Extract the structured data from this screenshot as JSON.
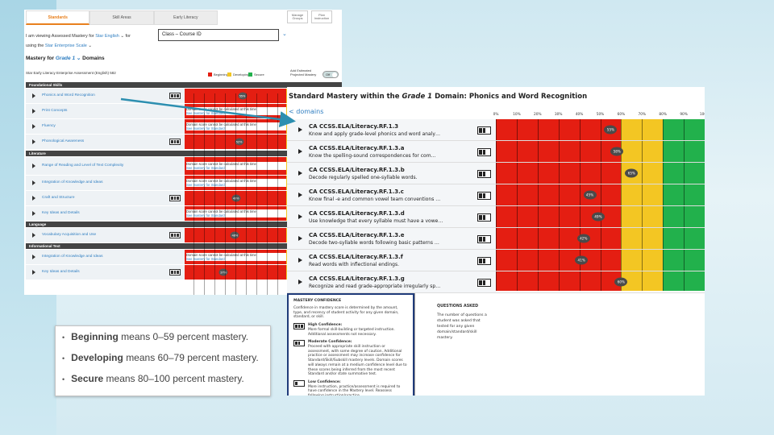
{
  "colors": {
    "beginning": "#e41e12",
    "developing": "#f3c623",
    "secure": "#22b14c",
    "link": "#2f7ec1",
    "arrow": "#2d8fb0"
  },
  "left": {
    "tabs": [
      "Standards",
      "Skill Areas",
      "Early Literacy"
    ],
    "top_buttons": [
      "Manage Groups",
      "Plan Instruction"
    ],
    "viewing_line": {
      "prefix": "I am viewing Assessed Mastery for",
      "subject": "Star English",
      "mid": "for"
    },
    "class_box": "Class – Course ID",
    "using_line": {
      "prefix": "using the",
      "scale": "Star Enterprise Scale"
    },
    "mastery_title": {
      "prefix": "Mastery for",
      "grade": "Grade 1",
      "suffix": "Domains"
    },
    "assessment": "Star Early Literacy Enterprise Assessment (English) 582",
    "legend": [
      "Beginning",
      "Developing",
      "Secure"
    ],
    "toggle_label": "Add Estimated Projected Mastery",
    "toggle_state": "Off",
    "percent_ticks": [
      "0%",
      "10%",
      "20%",
      "30%",
      "40%",
      "50%",
      "60%",
      "70%",
      "80%",
      "90%",
      "100%"
    ],
    "sections": [
      {
        "name": "Foundational Skills",
        "rows": [
          {
            "name": "Phonics and Word Recognition",
            "pct": "55%",
            "value": 55
          },
          {
            "name": "Print Concepts",
            "msg": "Domain score cannot be calculated at this time",
            "see": "See mastery for Standard"
          },
          {
            "name": "Fluency",
            "msg": "Domain score cannot be calculated at this time",
            "see": "See mastery for Standard"
          },
          {
            "name": "Phonological Awareness",
            "pct": "52%",
            "value": 52
          }
        ]
      },
      {
        "name": "Literature",
        "rows": [
          {
            "name": "Range of Reading and Level of Text Complexity",
            "msg": "Domain score cannot be calculated at this time",
            "see": "See mastery for Standard"
          },
          {
            "name": "Integration of Knowledge and Ideas",
            "msg": "Domain score cannot be calculated at this time",
            "see": "See mastery for Standard"
          },
          {
            "name": "Craft and Structure",
            "pct": "49%",
            "value": 49
          },
          {
            "name": "Key Ideas and Details",
            "msg": "Domain score cannot be calculated at this time",
            "see": "See mastery for Standard"
          }
        ]
      },
      {
        "name": "Language",
        "rows": [
          {
            "name": "Vocabulary Acquisition and Use",
            "pct": "48%",
            "value": 48
          }
        ]
      },
      {
        "name": "Informational Text",
        "rows": [
          {
            "name": "Integration of Knowledge and Ideas",
            "msg": "Domain score cannot be calculated at this time",
            "see": "See mastery for Standard"
          },
          {
            "name": "Key Ideas and Details",
            "pct": "37%",
            "value": 37
          }
        ]
      }
    ]
  },
  "right": {
    "title": {
      "prefix": "Standard Mastery within the",
      "grade": "Grade 1",
      "suffix": "Domain: Phonics and Word Recognition"
    },
    "back": "< domains",
    "percent_ticks": [
      "0%",
      "10%",
      "20%",
      "30%",
      "40%",
      "50%",
      "60%",
      "70%",
      "80%",
      "90%",
      "100%"
    ],
    "rows": [
      {
        "code": "CA CCSS.ELA/Literacy.RF.1.3",
        "desc": "Know and apply grade-level phonics and word analy…",
        "pct": "55%",
        "value": 55
      },
      {
        "code": "CA CCSS.ELA/Literacy.RF.1.3.a",
        "desc": "Know the spelling-sound correspondences for com…",
        "pct": "58%",
        "value": 58
      },
      {
        "code": "CA CCSS.ELA/Literacy.RF.1.3.b",
        "desc": "Decode regularly spelled one-syllable words.",
        "pct": "65%",
        "value": 65
      },
      {
        "code": "CA CCSS.ELA/Literacy.RF.1.3.c",
        "desc": "Know final -e and common vowel team conventions …",
        "pct": "45%",
        "value": 45
      },
      {
        "code": "CA CCSS.ELA/Literacy.RF.1.3.d",
        "desc": "Use knowledge that every syllable must have a vowe…",
        "pct": "49%",
        "value": 49
      },
      {
        "code": "CA CCSS.ELA/Literacy.RF.1.3.e",
        "desc": "Decode two-syllable words following basic patterns …",
        "pct": "42%",
        "value": 42
      },
      {
        "code": "CA CCSS.ELA/Literacy.RF.1.3.f",
        "desc": "Read words with inflectional endings.",
        "pct": "41%",
        "value": 41
      },
      {
        "code": "CA CCSS.ELA/Literacy.RF.1.3.g",
        "desc": "Recognize and read grade-appropriate irregularly sp…",
        "pct": "60%",
        "value": 60
      }
    ],
    "confidence": {
      "title": "MASTERY CONFIDENCE",
      "intro": "Confidence in mastery score is determined by the amount, type, and recency of student activity for any given domain, standard, or skill.",
      "items": [
        {
          "title": "High Confidence:",
          "text": "More formal skill-building or targeted instruction. Additional assessments not necessary."
        },
        {
          "title": "Moderate Confidence:",
          "text": "Proceed with appropriate skill instruction or assessment, with some degree of caution. Additional practice or assessment may increase confidence for Standard/Skill/Subskill mastery levels. Domain scores will always remain at a medium confidence level due to these scores being inferred from the most recent Standard and/or state summative test."
        },
        {
          "title": "Low Confidence:",
          "text": "More instruction, practice/assessment is required to have confidence in the Mastery level. Reassess following instruction/practice."
        }
      ]
    },
    "questions": {
      "title": "QUESTIONS ASKED",
      "text": [
        "The number of questions a",
        "student was asked that",
        "tested for any given",
        "domain/standard/skill",
        "mastery."
      ]
    }
  },
  "definitions": [
    {
      "term": "Beginning",
      "rest": "means 0–59 percent mastery."
    },
    {
      "term": "Developing",
      "rest": "means 60–79 percent mastery."
    },
    {
      "term": "Secure",
      "rest": "means 80–100 percent mastery."
    }
  ]
}
